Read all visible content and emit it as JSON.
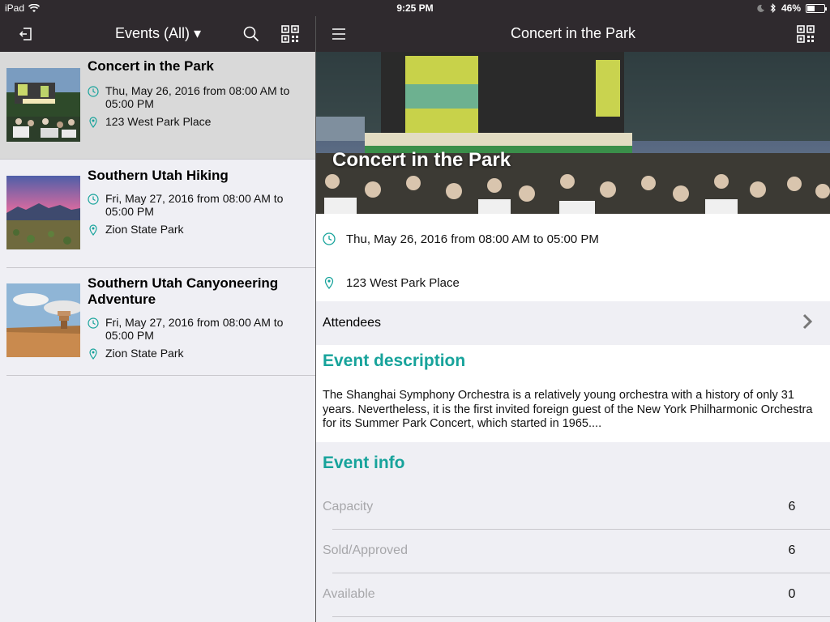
{
  "status_bar": {
    "device": "iPad",
    "time": "9:25 PM",
    "battery": "46%",
    "battery_level": 0.46
  },
  "left_nav": {
    "title": "Events (All) ▾",
    "icons": [
      "logout-icon",
      "search-icon",
      "qr-code-icon"
    ]
  },
  "events": [
    {
      "title": "Concert in the Park",
      "date": "Thu, May 26, 2016 from 08:00 AM to 05:00 PM",
      "location": "123 West Park Place",
      "selected": true
    },
    {
      "title": "Southern Utah Hiking",
      "date": "Fri, May 27, 2016 from 08:00 AM to 05:00 PM",
      "location": "Zion State Park",
      "selected": false
    },
    {
      "title": "Southern Utah Canyoneering Adventure",
      "date": "Fri, May 27, 2016 from 08:00 AM to 05:00 PM",
      "location": "Zion State Park",
      "selected": false
    }
  ],
  "detail_nav": {
    "title": "Concert in the Park",
    "icons": [
      "menu-icon",
      "qr-code-icon"
    ]
  },
  "detail": {
    "hero_title": "Concert in the Park",
    "date": "Thu, May 26, 2016 from 08:00 AM to 05:00 PM",
    "location": "123 West Park Place",
    "attendees_label": "Attendees",
    "description_heading": "Event description",
    "description": "The Shanghai Symphony Orchestra is a relatively young orchestra with a history of only 31 years. Nevertheless, it is the first invited foreign guest of the New York Philharmonic Orchestra for its Summer Park Concert, which started in 1965....",
    "info_heading": "Event info",
    "info": [
      {
        "label": "Capacity",
        "value": "6"
      },
      {
        "label": "Sold/Approved",
        "value": "6"
      },
      {
        "label": "Available",
        "value": "0"
      }
    ]
  },
  "colors": {
    "accent": "#17a39b",
    "navbar": "#2f2a2e",
    "background": "#efeff4",
    "selected_row": "#d9d9d9"
  }
}
